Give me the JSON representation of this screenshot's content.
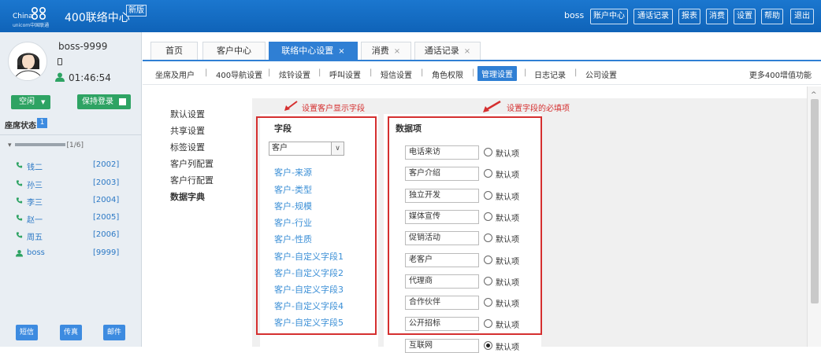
{
  "header": {
    "logo_text": "China",
    "logo_sub": "unicom中国联通",
    "title": "400联络中心",
    "badge": "新版",
    "user": "boss",
    "nav": [
      "账户中心",
      "通话记录",
      "报表",
      "消费",
      "设置",
      "帮助",
      "退出"
    ]
  },
  "sidebar": {
    "username": "boss-9999",
    "timer": "01:46:54",
    "status": "空闲",
    "keep_login": "保持登录",
    "seat_status_label": "座席状态",
    "seat_count": "1",
    "group_label": "[1/6]",
    "agents": [
      {
        "name": "钱二",
        "ext": "[2002]"
      },
      {
        "name": "孙三",
        "ext": "[2003]"
      },
      {
        "name": "李三",
        "ext": "[2004]"
      },
      {
        "name": "赵一",
        "ext": "[2005]"
      },
      {
        "name": "周五",
        "ext": "[2006]"
      },
      {
        "name": "boss",
        "ext": "[9999]"
      }
    ],
    "bottom_buttons": [
      "短信",
      "传真",
      "邮件"
    ]
  },
  "tabs": [
    {
      "label": "首页"
    },
    {
      "label": "客户中心"
    },
    {
      "label": "联络中心设置",
      "close": "×"
    },
    {
      "label": "消费",
      "close": "×"
    },
    {
      "label": "通话记录",
      "close": "×"
    }
  ],
  "subnav": {
    "items": [
      "坐席及用户",
      "400导航设置",
      "炫铃设置",
      "呼叫设置",
      "短信设置",
      "角色权限",
      "管理设置",
      "日志记录",
      "公司设置"
    ],
    "active_index": 6,
    "more": "更多400增值功能"
  },
  "left_menu": {
    "items": [
      "默认设置",
      "共享设置",
      "标签设置",
      "客户列配置",
      "客户行配置",
      "数据字典"
    ],
    "active_index": 5
  },
  "annotations": {
    "left": "设置客户显示字段",
    "right": "设置字段的必填项"
  },
  "field_panel": {
    "title": "字段",
    "select_value": "客户",
    "items": [
      "客户-来源",
      "客户-类型",
      "客户-规模",
      "客户-行业",
      "客户-性质",
      "客户-自定义字段1",
      "客户-自定义字段2",
      "客户-自定义字段3",
      "客户-自定义字段4",
      "客户-自定义字段5"
    ]
  },
  "data_panel": {
    "title": "数据项",
    "radio_label": "默认项",
    "items": [
      {
        "value": "电话来访",
        "default": false
      },
      {
        "value": "客户介绍",
        "default": false
      },
      {
        "value": "独立开发",
        "default": false
      },
      {
        "value": "媒体宣传",
        "default": false
      },
      {
        "value": "促销活动",
        "default": false
      },
      {
        "value": "老客户",
        "default": false
      },
      {
        "value": "代理商",
        "default": false
      },
      {
        "value": "合作伙伴",
        "default": false
      },
      {
        "value": "公开招标",
        "default": false
      },
      {
        "value": "互联网",
        "default": true
      }
    ]
  },
  "colors": {
    "header_blue": "#1b77cf",
    "accent_blue": "#2f7fd4",
    "green": "#2ea363",
    "red_highlight": "#d52f2f",
    "link_blue": "#3b8fd6"
  }
}
